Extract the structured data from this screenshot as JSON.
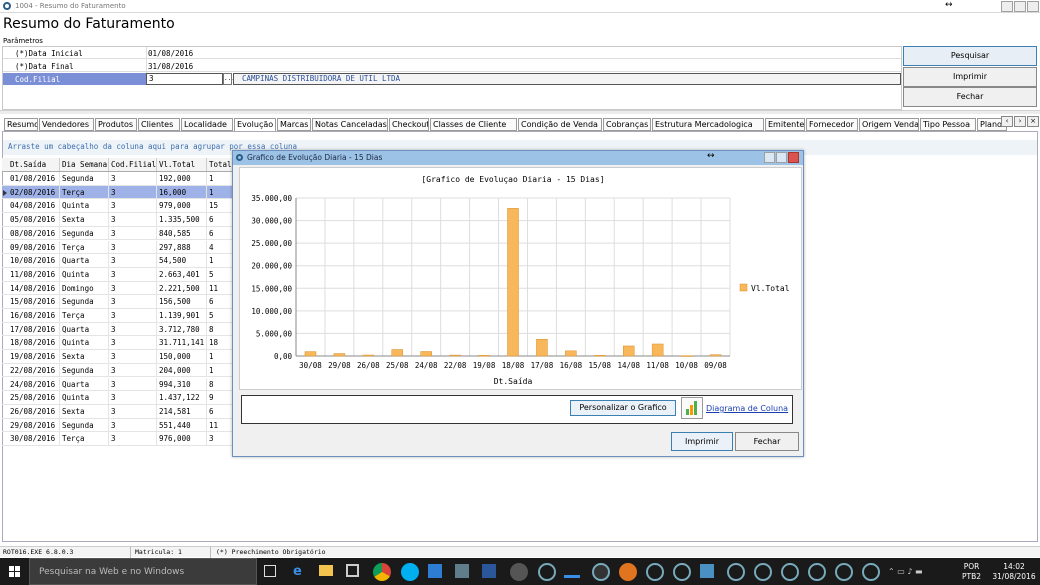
{
  "window": {
    "title": "1004 - Resumo do Faturamento",
    "heading": "Resumo do Faturamento",
    "params_label": "Parâmetros"
  },
  "params": [
    {
      "label": "(*)Data Inicial",
      "value": "01/08/2016"
    },
    {
      "label": "(*)Data Final",
      "value": "31/08/2016"
    },
    {
      "label": "Cod.Filial",
      "value": "3",
      "desc": "CAMPINAS DISTRIBUIDORA DE UTIL LTDA",
      "ellipsis": "..."
    }
  ],
  "actions": {
    "pesquisar": "Pesquisar",
    "imprimir": "Imprimir",
    "fechar": "Fechar"
  },
  "tabs": [
    "Resumo",
    "Vendedores",
    "Produtos",
    "Clientes",
    "Localidade",
    "Evolução",
    "Marcas",
    "Notas Canceladas",
    "Checkout",
    "Classes de Cliente",
    "Condição de Venda",
    "Cobranças",
    "Estrutura Mercadologica",
    "Emitente",
    "Fornecedor",
    "Origem Venda",
    "Tipo Pessoa",
    "Plano"
  ],
  "active_tab": "Evolução",
  "group_hint": "Arraste um cabeçalho da coluna aqui para agrupar por essa coluna",
  "grid": {
    "columns": [
      "Dt.Saída",
      "Dia Semana",
      "Cod.Filial",
      "Vl.Total",
      "Total"
    ],
    "rows": [
      [
        "01/08/2016",
        "Segunda",
        "3",
        "192,000",
        "1"
      ],
      [
        "02/08/2016",
        "Terça",
        "3",
        "16,000",
        "1"
      ],
      [
        "04/08/2016",
        "Quinta",
        "3",
        "979,000",
        "15"
      ],
      [
        "05/08/2016",
        "Sexta",
        "3",
        "1.335,500",
        "6"
      ],
      [
        "08/08/2016",
        "Segunda",
        "3",
        "840,585",
        "6"
      ],
      [
        "09/08/2016",
        "Terça",
        "3",
        "297,888",
        "4"
      ],
      [
        "10/08/2016",
        "Quarta",
        "3",
        "54,500",
        "1"
      ],
      [
        "11/08/2016",
        "Quinta",
        "3",
        "2.663,401",
        "5"
      ],
      [
        "14/08/2016",
        "Domingo",
        "3",
        "2.221,500",
        "11"
      ],
      [
        "15/08/2016",
        "Segunda",
        "3",
        "156,500",
        "6"
      ],
      [
        "16/08/2016",
        "Terça",
        "3",
        "1.139,901",
        "5"
      ],
      [
        "17/08/2016",
        "Quarta",
        "3",
        "3.712,780",
        "8"
      ],
      [
        "18/08/2016",
        "Quinta",
        "3",
        "31.711,141",
        "18"
      ],
      [
        "19/08/2016",
        "Sexta",
        "3",
        "150,000",
        "1"
      ],
      [
        "22/08/2016",
        "Segunda",
        "3",
        "204,000",
        "1"
      ],
      [
        "24/08/2016",
        "Quarta",
        "3",
        "994,310",
        "8"
      ],
      [
        "25/08/2016",
        "Quinta",
        "3",
        "1.437,122",
        "9"
      ],
      [
        "26/08/2016",
        "Sexta",
        "3",
        "214,581",
        "6"
      ],
      [
        "29/08/2016",
        "Segunda",
        "3",
        "551,440",
        "11"
      ],
      [
        "30/08/2016",
        "Terça",
        "3",
        "976,000",
        "3"
      ]
    ],
    "selected_row": 1
  },
  "dialog": {
    "title": "Grafico de Evolução Diaria - 15 Dias",
    "custom_btn": "Personalizar o Grafico",
    "link": "Diagrama de Coluna",
    "imprimir": "Imprimir",
    "fechar": "Fechar"
  },
  "chart_data": {
    "type": "bar",
    "title": "[Grafico de Evoluçao Diaria - 15 Dias]",
    "xlabel": "Dt.Saída",
    "ylabel": "",
    "categories": [
      "30/08",
      "29/08",
      "26/08",
      "25/08",
      "24/08",
      "22/08",
      "19/08",
      "18/08",
      "17/08",
      "16/08",
      "15/08",
      "14/08",
      "11/08",
      "10/08",
      "09/08"
    ],
    "series": [
      {
        "name": "Vl.Total",
        "values": [
          976,
          551.44,
          214.581,
          1437.122,
          994.31,
          204,
          150,
          32711.141,
          3712.78,
          1139.901,
          156.5,
          2221.5,
          2663.401,
          54.5,
          297.888
        ]
      }
    ],
    "ylim": [
      0,
      35000
    ],
    "yticks": [
      "0,00",
      "5.000,00",
      "10.000,00",
      "15.000,00",
      "20.000,00",
      "25.000,00",
      "30.000,00",
      "35.000,00"
    ],
    "grid": true,
    "legend": "right",
    "bar_color": "#f8b75a"
  },
  "status": [
    "ROT016.EXE 6.8.0.3",
    "Matricula: 1",
    "(*) Preechimento Obrigatório"
  ],
  "taskbar": {
    "search": "Pesquisar na Web e no Windows",
    "lang1": "POR",
    "lang2": "PTB2",
    "time": "14:02",
    "date": "31/08/2016"
  }
}
